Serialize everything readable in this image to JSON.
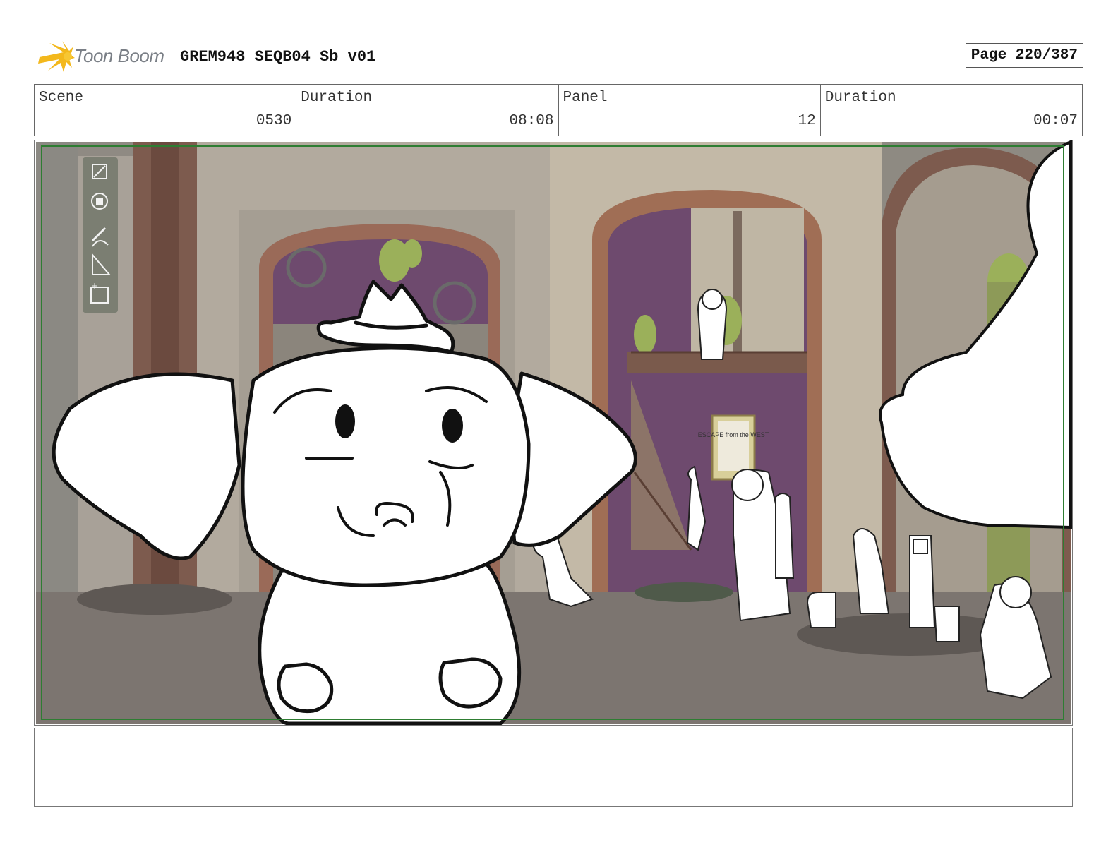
{
  "header": {
    "logo_text": "Toon Boom",
    "project_title": "GREM948 SEQB04 Sb v01",
    "page_label": "Page 220/387"
  },
  "info": [
    {
      "label": "Scene",
      "value": "0530"
    },
    {
      "label": "Duration",
      "value": "08:08"
    },
    {
      "label": "Panel",
      "value": "12"
    },
    {
      "label": "Duration",
      "value": "00:07"
    }
  ],
  "panel": {
    "poster_text": "ESCAPE from the WEST",
    "colors": {
      "frame_border": "#2e7d32",
      "background_wall": "#9b958c",
      "arch_wood": "#9a6a58",
      "purple_back": "#6e4a6e",
      "cactus": "#9bb05a",
      "toolbar": "#6c7366"
    },
    "toolbar_icons": [
      "scale-icon",
      "move-icon",
      "pencil-icon",
      "ruler-icon",
      "add-camera-icon"
    ]
  },
  "notes": {
    "text": ""
  }
}
